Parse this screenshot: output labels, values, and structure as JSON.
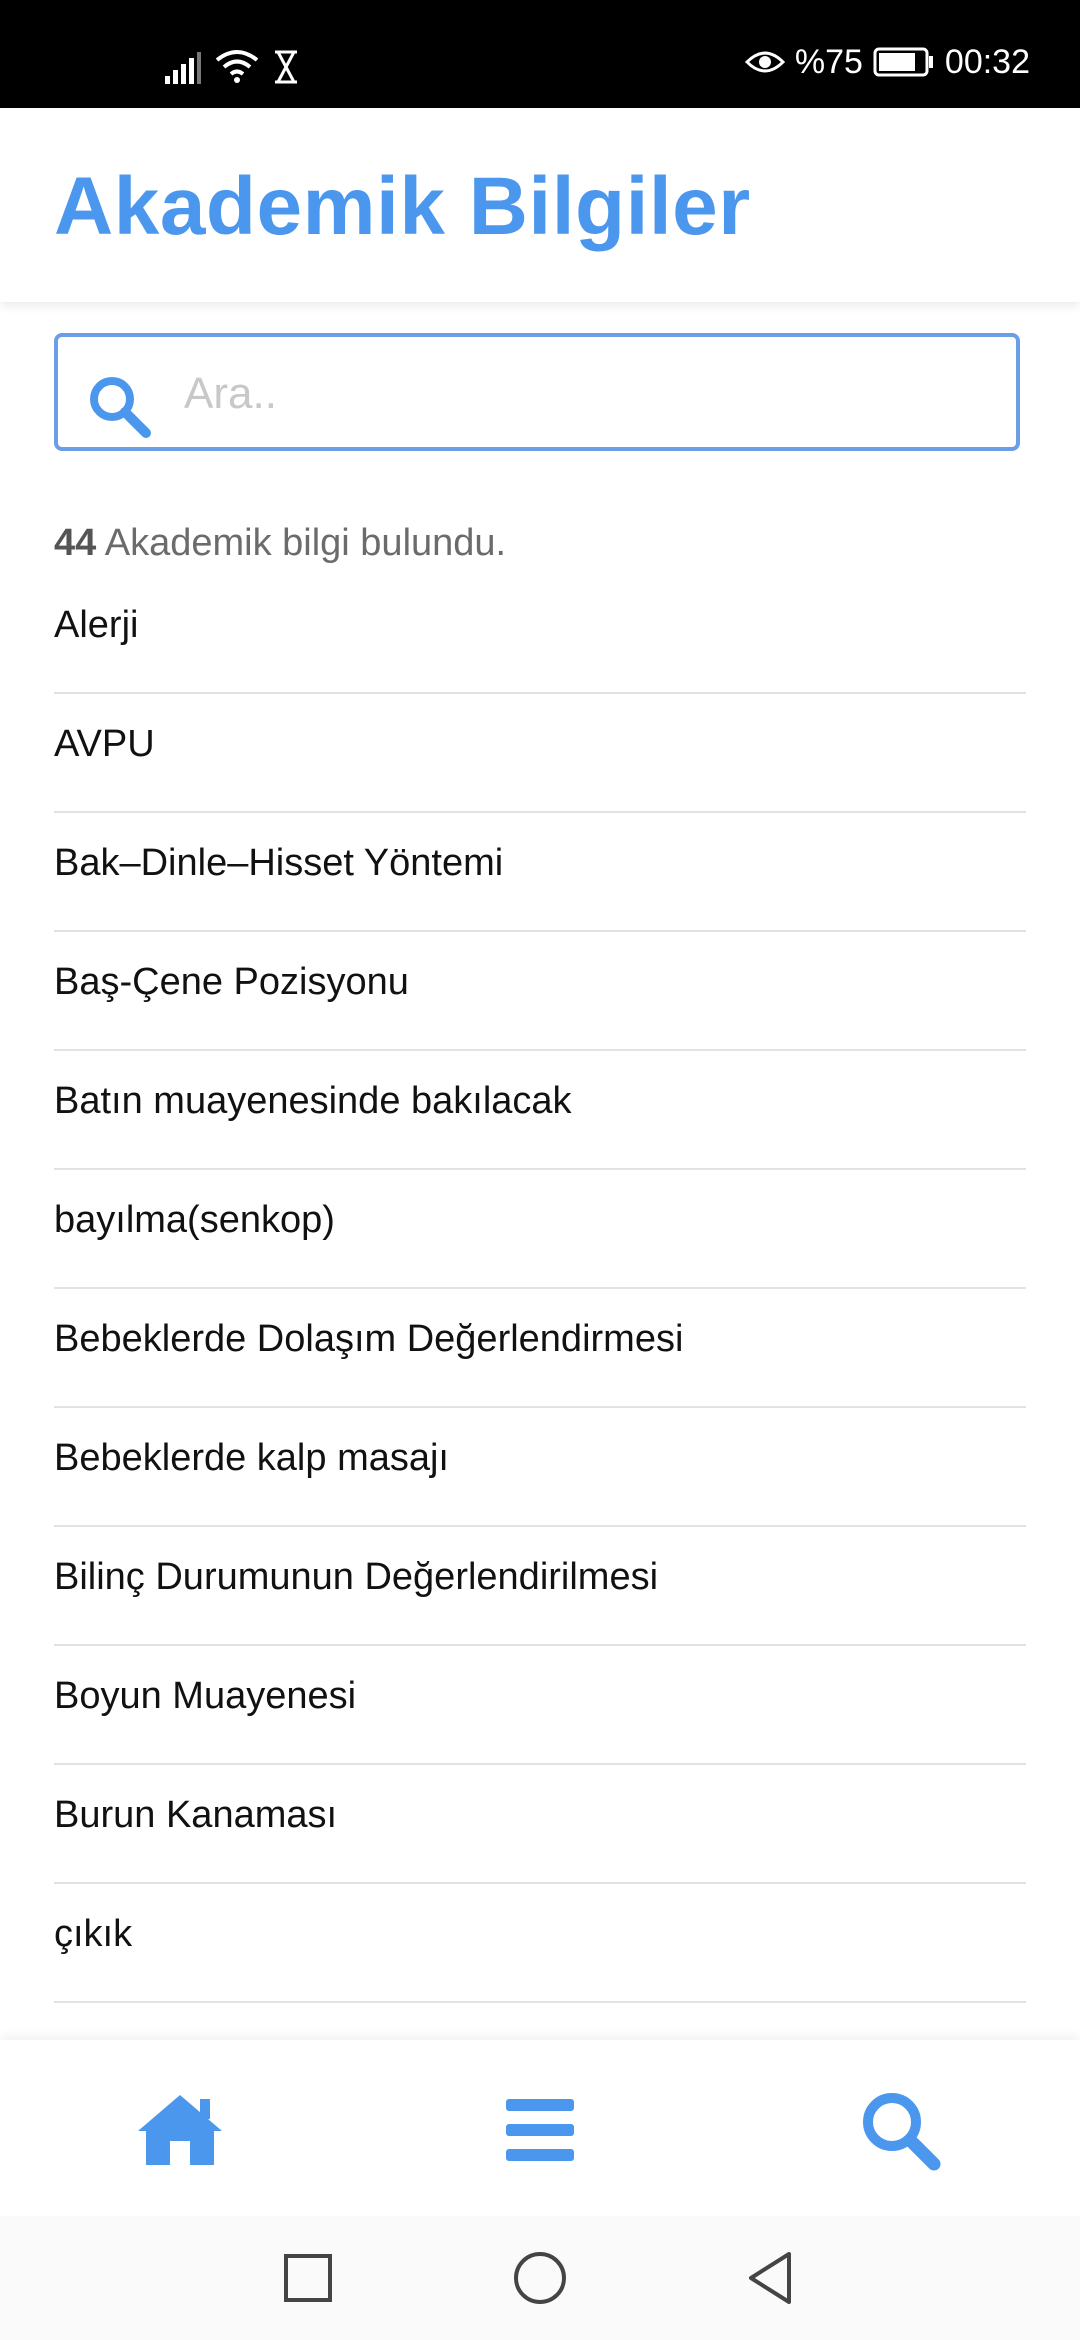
{
  "status_bar": {
    "battery": "%75",
    "time": "00:32"
  },
  "header": {
    "title": "Akademik Bilgiler"
  },
  "search": {
    "placeholder": "Ara..",
    "value": ""
  },
  "results": {
    "count": "44",
    "text": " Akademik bilgi bulundu."
  },
  "items": [
    "Alerji",
    "AVPU",
    "Bak–Dinle–Hisset Yöntemi",
    "Baş-Çene Pozisyonu",
    "Batın muayenesinde bakılacak",
    "bayılma(senkop)",
    "Bebeklerde Dolaşım Değerlendirmesi",
    "Bebeklerde kalp masajı",
    "Bilinç Durumunun Değerlendirilmesi",
    "Boyun Muayenesi",
    "Burun Kanaması",
    "çıkık"
  ],
  "bottom_nav": {
    "icons": [
      "home-icon",
      "menu-icon",
      "search-icon"
    ]
  },
  "system_nav": {
    "icons": [
      "recents-square-icon",
      "home-circle-icon",
      "back-triangle-icon"
    ]
  },
  "colors": {
    "accent": "#4b97ee",
    "border": "#6a9ee6"
  }
}
